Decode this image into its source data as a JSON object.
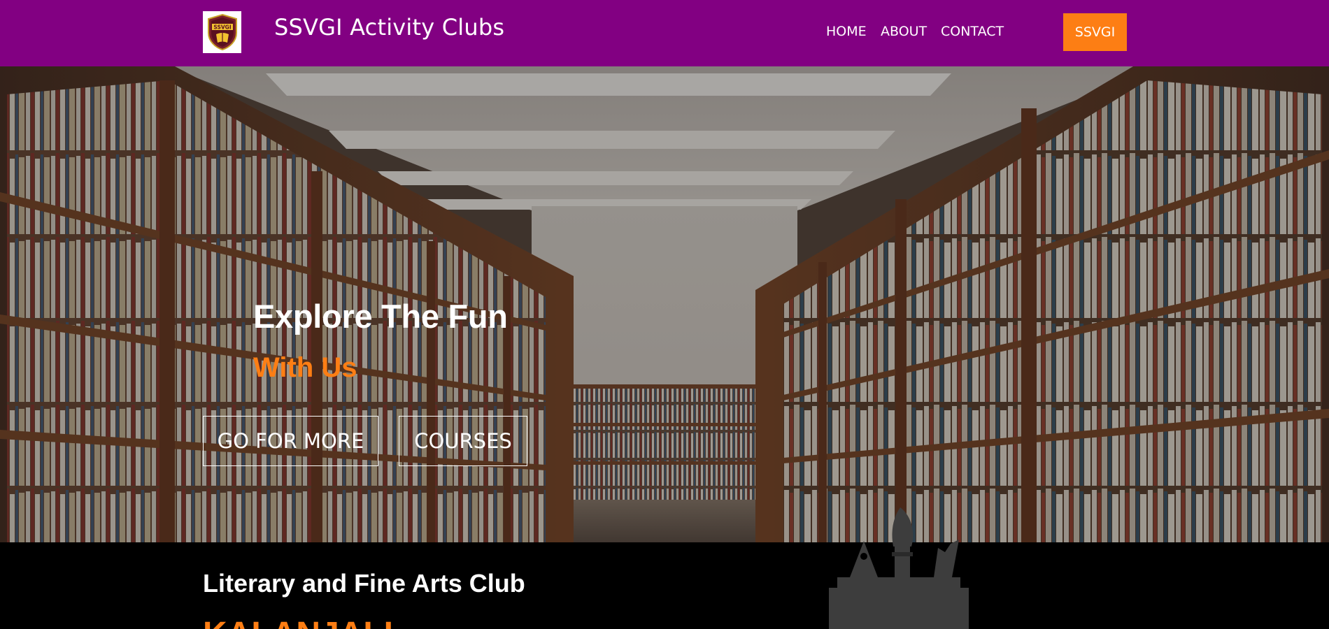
{
  "navbar": {
    "brand": "SSVGI Activity Clubs",
    "logo_text": "SSVGI",
    "links": [
      "HOME",
      "ABOUT",
      "CONTACT"
    ],
    "cta_label": "SSVGI",
    "background_color": "#820082",
    "cta_color": "#fd7e14"
  },
  "hero": {
    "title": "Explore The Fun",
    "subtitle": "With Us",
    "buttons": [
      "GO FOR MORE",
      "COURSES"
    ],
    "background_image": "library-bookshelves-icon",
    "accent_color": "#fd7e14"
  },
  "club": {
    "heading": "Literary and Fine Arts Club",
    "name": "KALANJALI",
    "icon": "pen-and-brush-icon"
  }
}
